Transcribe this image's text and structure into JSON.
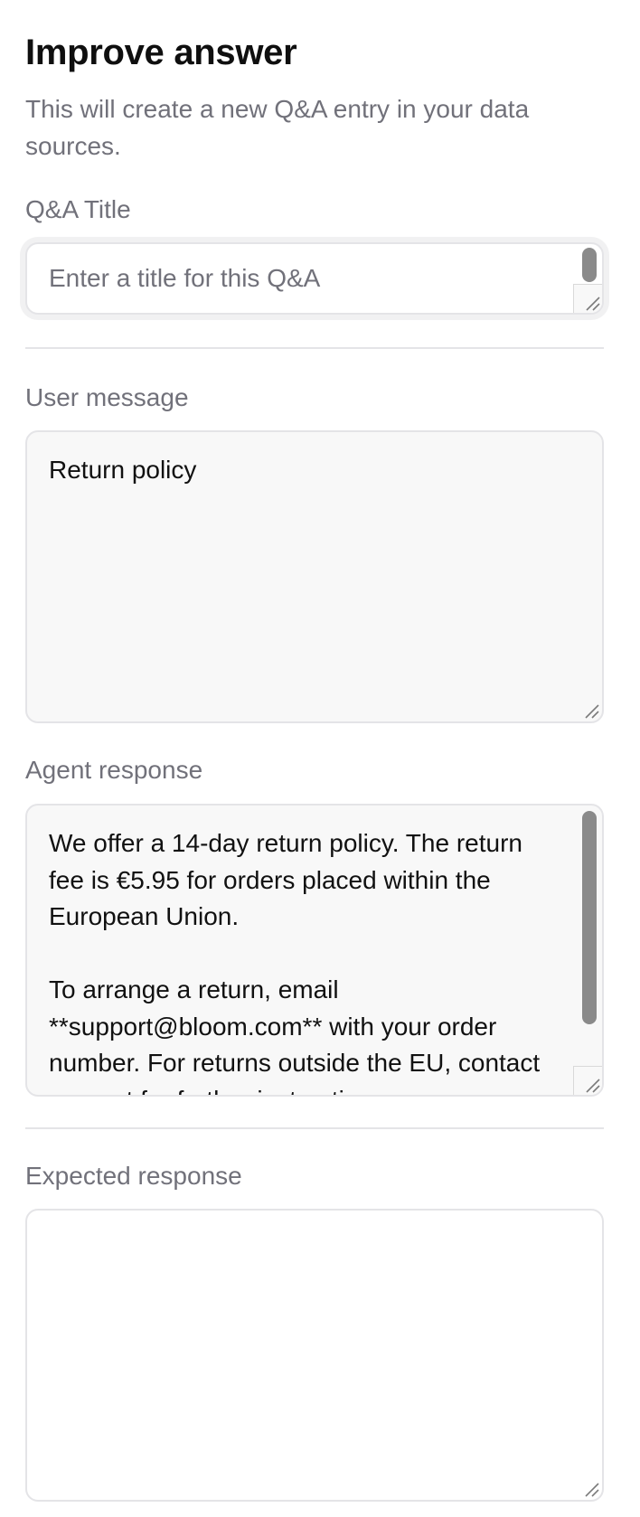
{
  "header": {
    "title": "Improve answer",
    "subtitle": "This will create a new Q&A entry in your data sources."
  },
  "qa_title": {
    "label": "Q&A Title",
    "placeholder": "Enter a title for this Q&A",
    "value": ""
  },
  "user_message": {
    "label": "User message",
    "value": "Return policy"
  },
  "agent_response": {
    "label": "Agent response",
    "value": "We offer a 14-day return policy. The return fee is €5.95 for orders placed within the European Union.\n\nTo arrange a return, email **support@bloom.com** with your order number. For returns outside the EU, contact support for further instructions."
  },
  "expected_response": {
    "label": "Expected response",
    "value": ""
  }
}
